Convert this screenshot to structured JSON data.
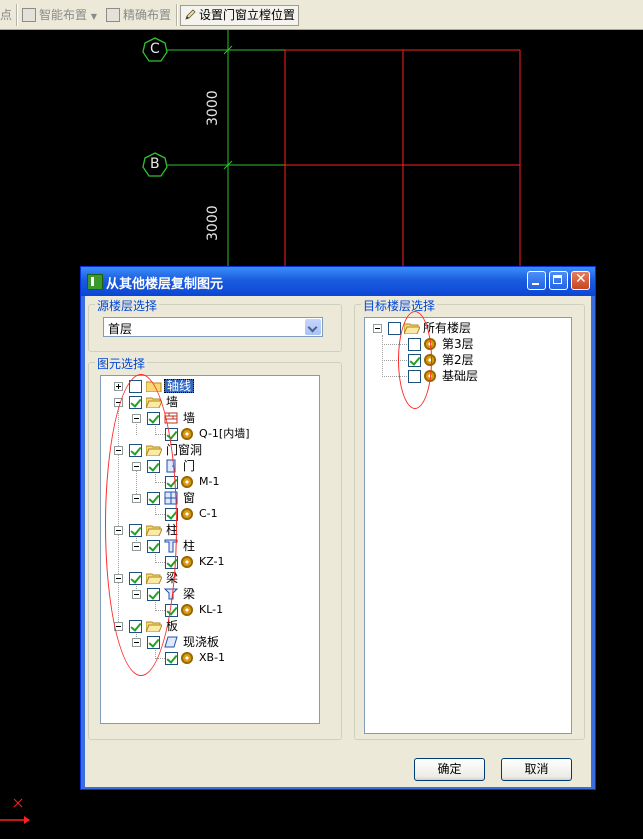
{
  "toolbar": {
    "items": [
      {
        "label": "点",
        "enabled": false
      },
      {
        "label": "智能布置",
        "enabled": false
      },
      {
        "label": "精确布置",
        "enabled": false
      },
      {
        "label": "设置门窗立樘位置",
        "enabled": true
      }
    ]
  },
  "cad": {
    "axis_labels": [
      "C",
      "B"
    ],
    "dimensions": [
      "3000",
      "3000"
    ],
    "colors": {
      "axis_circle": "#30c030",
      "grid": "#ff2020",
      "axis_line": "#30c030"
    }
  },
  "dialog": {
    "title": "从其他楼层复制图元",
    "source_group_title": "源楼层选择",
    "source_floor": "首层",
    "element_group_title": "图元选择",
    "target_group_title": "目标楼层选择",
    "ok_label": "确定",
    "cancel_label": "取消",
    "element_tree": [
      {
        "label": "轴线",
        "checked": false,
        "selected": true
      },
      {
        "label": "墙",
        "checked": true
      },
      {
        "label": "墙",
        "checked": true
      },
      {
        "label": "Q-1[内墙]",
        "checked": true
      },
      {
        "label": "门窗洞",
        "checked": true
      },
      {
        "label": "门",
        "checked": true
      },
      {
        "label": "M-1",
        "checked": true
      },
      {
        "label": "窗",
        "checked": true
      },
      {
        "label": "C-1",
        "checked": true
      },
      {
        "label": "柱",
        "checked": true
      },
      {
        "label": "柱",
        "checked": true
      },
      {
        "label": "KZ-1",
        "checked": true
      },
      {
        "label": "梁",
        "checked": true
      },
      {
        "label": "梁",
        "checked": true
      },
      {
        "label": "KL-1",
        "checked": true
      },
      {
        "label": "板",
        "checked": true
      },
      {
        "label": "现浇板",
        "checked": true
      },
      {
        "label": "XB-1",
        "checked": true
      }
    ],
    "target_tree": [
      {
        "label": "所有楼层",
        "checked": false
      },
      {
        "label": "第3层",
        "checked": false
      },
      {
        "label": "第2层",
        "checked": true
      },
      {
        "label": "基础层",
        "checked": false
      }
    ]
  }
}
